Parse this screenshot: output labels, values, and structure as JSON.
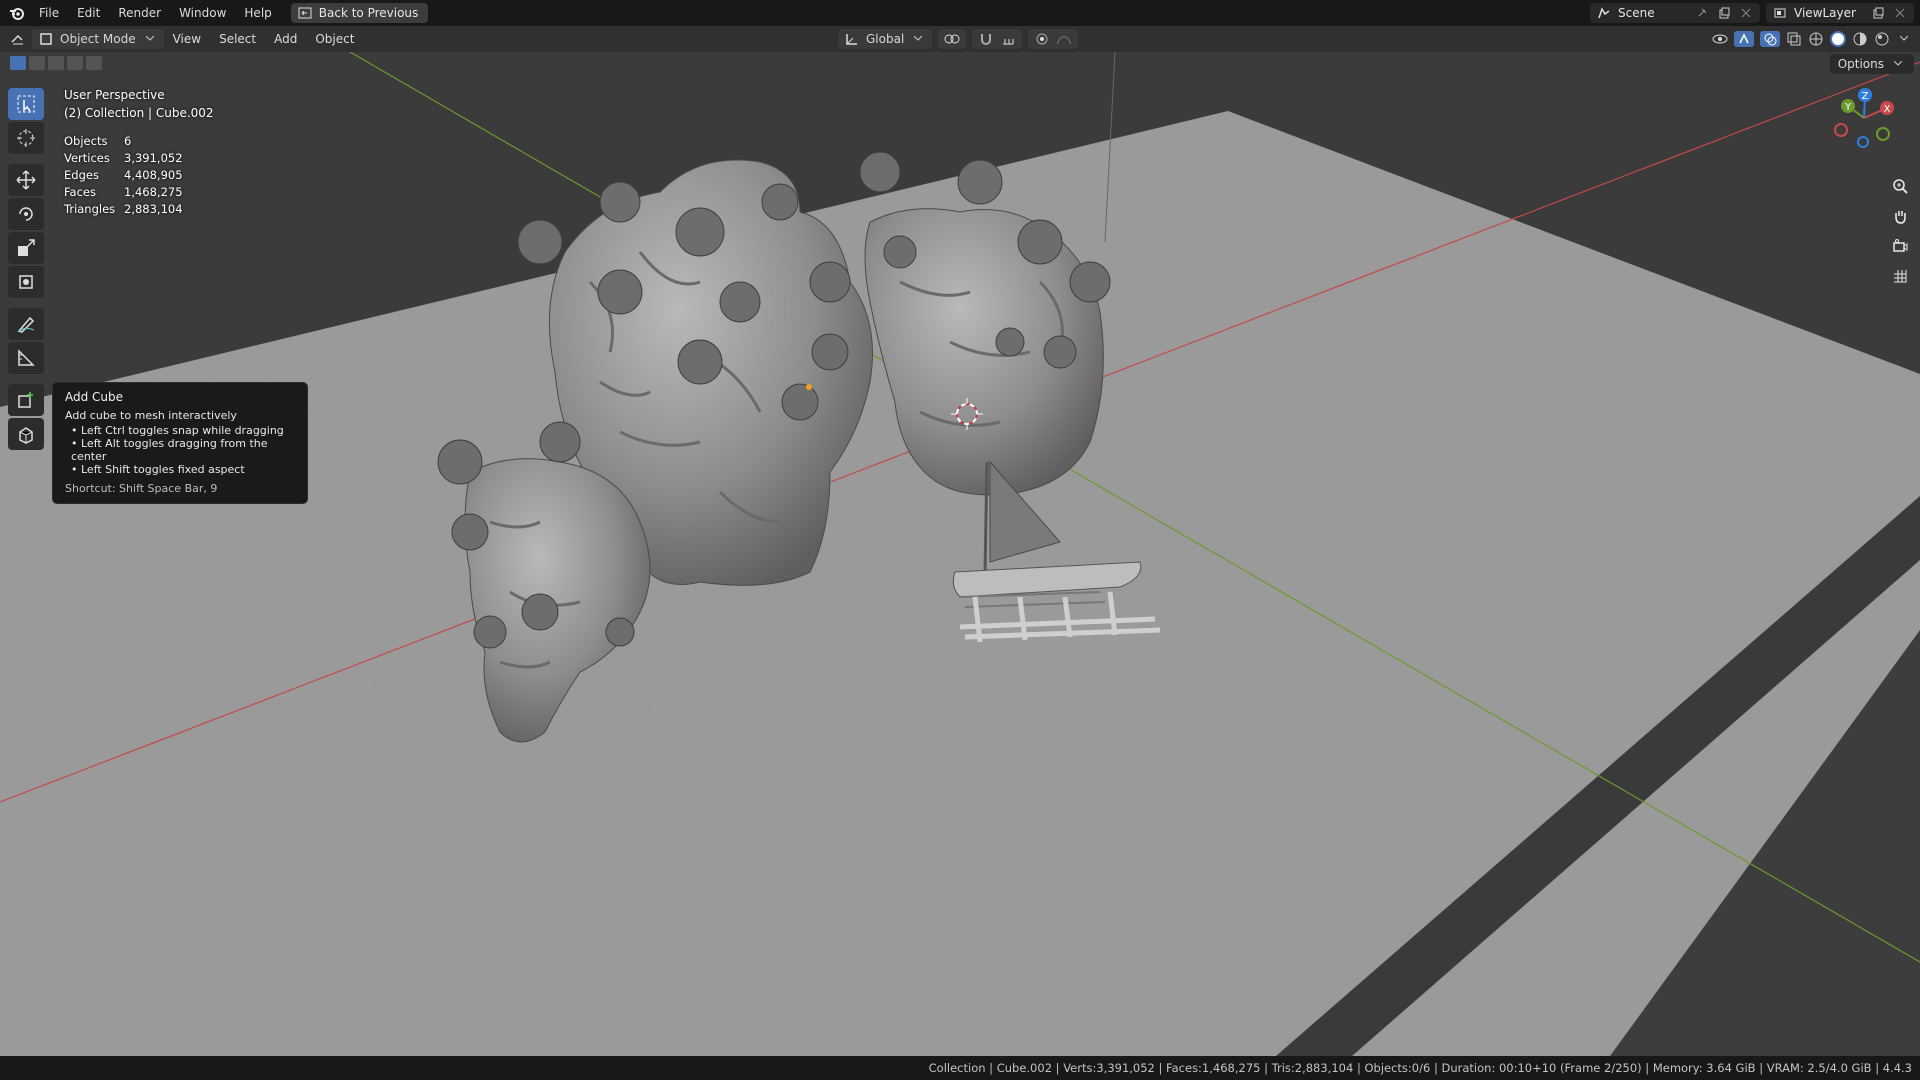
{
  "topbar": {
    "menus": [
      "File",
      "Edit",
      "Render",
      "Window",
      "Help"
    ],
    "back_button": "Back to Previous",
    "scene_name": "Scene",
    "view_layer": "ViewLayer"
  },
  "viewport_header": {
    "mode": "Object Mode",
    "menus": [
      "View",
      "Select",
      "Add",
      "Object"
    ],
    "transform_orientation": "Global",
    "options_label": "Options"
  },
  "overlay": {
    "view_name": "User Perspective",
    "context": "(2) Collection | Cube.002",
    "stats": [
      {
        "label": "Objects",
        "value": "6"
      },
      {
        "label": "Vertices",
        "value": "3,391,052"
      },
      {
        "label": "Edges",
        "value": "4,408,905"
      },
      {
        "label": "Faces",
        "value": "1,468,275"
      },
      {
        "label": "Triangles",
        "value": "2,883,104"
      }
    ]
  },
  "tooltip": {
    "title": "Add Cube",
    "description": "Add cube to mesh interactively",
    "bullets": [
      "• Left Ctrl toggles snap while dragging",
      "• Left Alt toggles dragging from the center",
      "• Left Shift toggles fixed aspect"
    ],
    "shortcut": "Shortcut: Shift Space Bar, 9"
  },
  "gizmo": {
    "x": "X",
    "y": "Y",
    "z": "Z"
  },
  "statusbar": {
    "text": "Collection | Cube.002 | Verts:3,391,052 | Faces:1,468,275 | Tris:2,883,104 | Objects:0/6 | Duration: 00:10+10 (Frame 2/250) | Memory: 3.64 GiB | VRAM: 2.5/4.0 GiB | 4.4.3"
  },
  "colors": {
    "accent": "#4772b3",
    "x_axis": "#c94a4a",
    "y_axis": "#6d9a2c",
    "z_axis": "#2f7fe0"
  }
}
